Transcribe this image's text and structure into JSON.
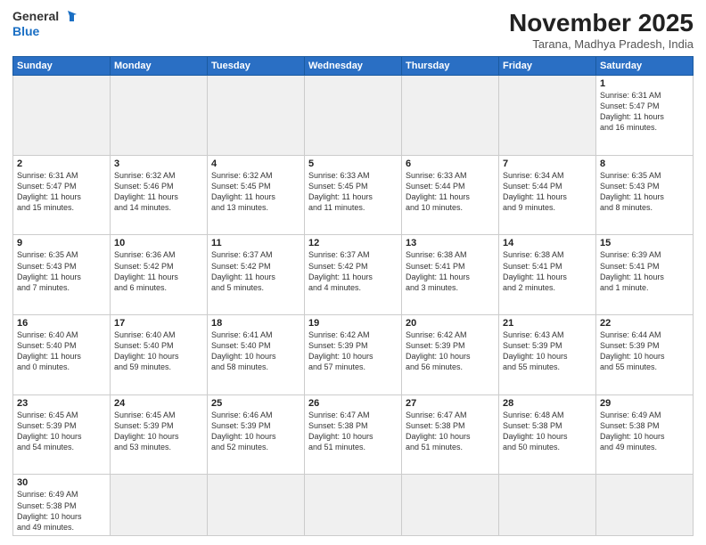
{
  "header": {
    "logo_line1": "General",
    "logo_line2": "Blue",
    "month_title": "November 2025",
    "subtitle": "Tarana, Madhya Pradesh, India"
  },
  "weekdays": [
    "Sunday",
    "Monday",
    "Tuesday",
    "Wednesday",
    "Thursday",
    "Friday",
    "Saturday"
  ],
  "weeks": [
    [
      {
        "day": "",
        "info": ""
      },
      {
        "day": "",
        "info": ""
      },
      {
        "day": "",
        "info": ""
      },
      {
        "day": "",
        "info": ""
      },
      {
        "day": "",
        "info": ""
      },
      {
        "day": "",
        "info": ""
      },
      {
        "day": "1",
        "info": "Sunrise: 6:31 AM\nSunset: 5:47 PM\nDaylight: 11 hours\nand 16 minutes."
      }
    ],
    [
      {
        "day": "2",
        "info": "Sunrise: 6:31 AM\nSunset: 5:47 PM\nDaylight: 11 hours\nand 15 minutes."
      },
      {
        "day": "3",
        "info": "Sunrise: 6:32 AM\nSunset: 5:46 PM\nDaylight: 11 hours\nand 14 minutes."
      },
      {
        "day": "4",
        "info": "Sunrise: 6:32 AM\nSunset: 5:45 PM\nDaylight: 11 hours\nand 13 minutes."
      },
      {
        "day": "5",
        "info": "Sunrise: 6:33 AM\nSunset: 5:45 PM\nDaylight: 11 hours\nand 11 minutes."
      },
      {
        "day": "6",
        "info": "Sunrise: 6:33 AM\nSunset: 5:44 PM\nDaylight: 11 hours\nand 10 minutes."
      },
      {
        "day": "7",
        "info": "Sunrise: 6:34 AM\nSunset: 5:44 PM\nDaylight: 11 hours\nand 9 minutes."
      },
      {
        "day": "8",
        "info": "Sunrise: 6:35 AM\nSunset: 5:43 PM\nDaylight: 11 hours\nand 8 minutes."
      }
    ],
    [
      {
        "day": "9",
        "info": "Sunrise: 6:35 AM\nSunset: 5:43 PM\nDaylight: 11 hours\nand 7 minutes."
      },
      {
        "day": "10",
        "info": "Sunrise: 6:36 AM\nSunset: 5:42 PM\nDaylight: 11 hours\nand 6 minutes."
      },
      {
        "day": "11",
        "info": "Sunrise: 6:37 AM\nSunset: 5:42 PM\nDaylight: 11 hours\nand 5 minutes."
      },
      {
        "day": "12",
        "info": "Sunrise: 6:37 AM\nSunset: 5:42 PM\nDaylight: 11 hours\nand 4 minutes."
      },
      {
        "day": "13",
        "info": "Sunrise: 6:38 AM\nSunset: 5:41 PM\nDaylight: 11 hours\nand 3 minutes."
      },
      {
        "day": "14",
        "info": "Sunrise: 6:38 AM\nSunset: 5:41 PM\nDaylight: 11 hours\nand 2 minutes."
      },
      {
        "day": "15",
        "info": "Sunrise: 6:39 AM\nSunset: 5:41 PM\nDaylight: 11 hours\nand 1 minute."
      }
    ],
    [
      {
        "day": "16",
        "info": "Sunrise: 6:40 AM\nSunset: 5:40 PM\nDaylight: 11 hours\nand 0 minutes."
      },
      {
        "day": "17",
        "info": "Sunrise: 6:40 AM\nSunset: 5:40 PM\nDaylight: 10 hours\nand 59 minutes."
      },
      {
        "day": "18",
        "info": "Sunrise: 6:41 AM\nSunset: 5:40 PM\nDaylight: 10 hours\nand 58 minutes."
      },
      {
        "day": "19",
        "info": "Sunrise: 6:42 AM\nSunset: 5:39 PM\nDaylight: 10 hours\nand 57 minutes."
      },
      {
        "day": "20",
        "info": "Sunrise: 6:42 AM\nSunset: 5:39 PM\nDaylight: 10 hours\nand 56 minutes."
      },
      {
        "day": "21",
        "info": "Sunrise: 6:43 AM\nSunset: 5:39 PM\nDaylight: 10 hours\nand 55 minutes."
      },
      {
        "day": "22",
        "info": "Sunrise: 6:44 AM\nSunset: 5:39 PM\nDaylight: 10 hours\nand 55 minutes."
      }
    ],
    [
      {
        "day": "23",
        "info": "Sunrise: 6:45 AM\nSunset: 5:39 PM\nDaylight: 10 hours\nand 54 minutes."
      },
      {
        "day": "24",
        "info": "Sunrise: 6:45 AM\nSunset: 5:39 PM\nDaylight: 10 hours\nand 53 minutes."
      },
      {
        "day": "25",
        "info": "Sunrise: 6:46 AM\nSunset: 5:39 PM\nDaylight: 10 hours\nand 52 minutes."
      },
      {
        "day": "26",
        "info": "Sunrise: 6:47 AM\nSunset: 5:38 PM\nDaylight: 10 hours\nand 51 minutes."
      },
      {
        "day": "27",
        "info": "Sunrise: 6:47 AM\nSunset: 5:38 PM\nDaylight: 10 hours\nand 51 minutes."
      },
      {
        "day": "28",
        "info": "Sunrise: 6:48 AM\nSunset: 5:38 PM\nDaylight: 10 hours\nand 50 minutes."
      },
      {
        "day": "29",
        "info": "Sunrise: 6:49 AM\nSunset: 5:38 PM\nDaylight: 10 hours\nand 49 minutes."
      }
    ],
    [
      {
        "day": "30",
        "info": "Sunrise: 6:49 AM\nSunset: 5:38 PM\nDaylight: 10 hours\nand 49 minutes."
      },
      {
        "day": "",
        "info": ""
      },
      {
        "day": "",
        "info": ""
      },
      {
        "day": "",
        "info": ""
      },
      {
        "day": "",
        "info": ""
      },
      {
        "day": "",
        "info": ""
      },
      {
        "day": "",
        "info": ""
      }
    ]
  ]
}
